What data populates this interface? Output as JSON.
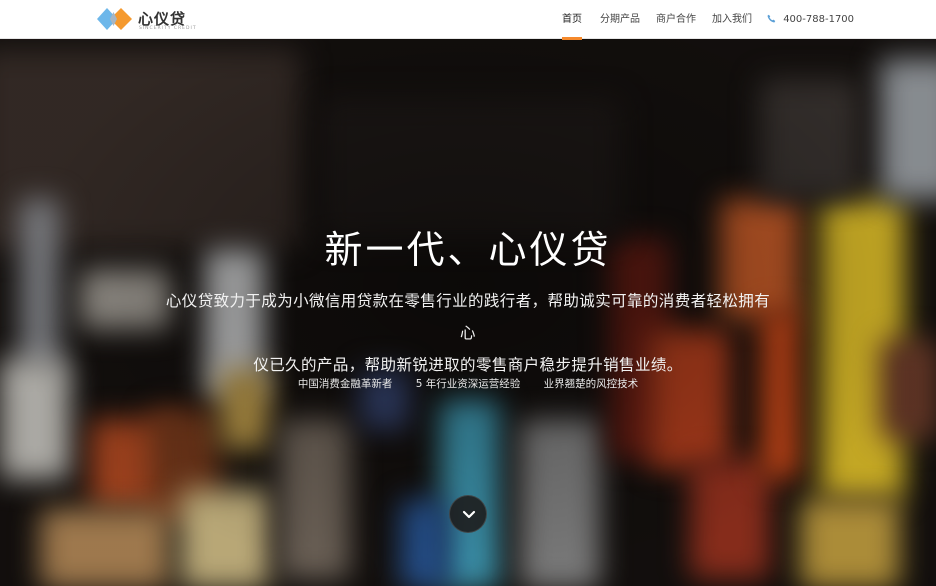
{
  "brand": {
    "name": "心仪贷",
    "sub": "SINCERITY CREDIT"
  },
  "nav": {
    "items": [
      {
        "label": "首页",
        "active": true
      },
      {
        "label": "分期产品",
        "active": false
      },
      {
        "label": "商户合作",
        "active": false
      },
      {
        "label": "加入我们",
        "active": false
      }
    ],
    "phone": "400-788-1700",
    "phone_icon": "phone-icon"
  },
  "hero": {
    "title": "新一代、心仪贷",
    "desc_line1": "心仪贷致力于成为小微信用贷款在零售行业的践行者，帮助诚实可靠的消费者轻松拥有心",
    "desc_line2": "仪已久的产品，帮助新锐进取的零售商户稳步提升销售业绩。",
    "features": [
      "中国消费金融革新者",
      "5 年行业资深运营经验",
      "业界翘楚的风控技术"
    ],
    "scroll_icon": "chevron-down-icon"
  },
  "colors": {
    "accent": "#f5892b",
    "logo_blue": "#5aaee6",
    "logo_orange": "#f59a2f"
  }
}
